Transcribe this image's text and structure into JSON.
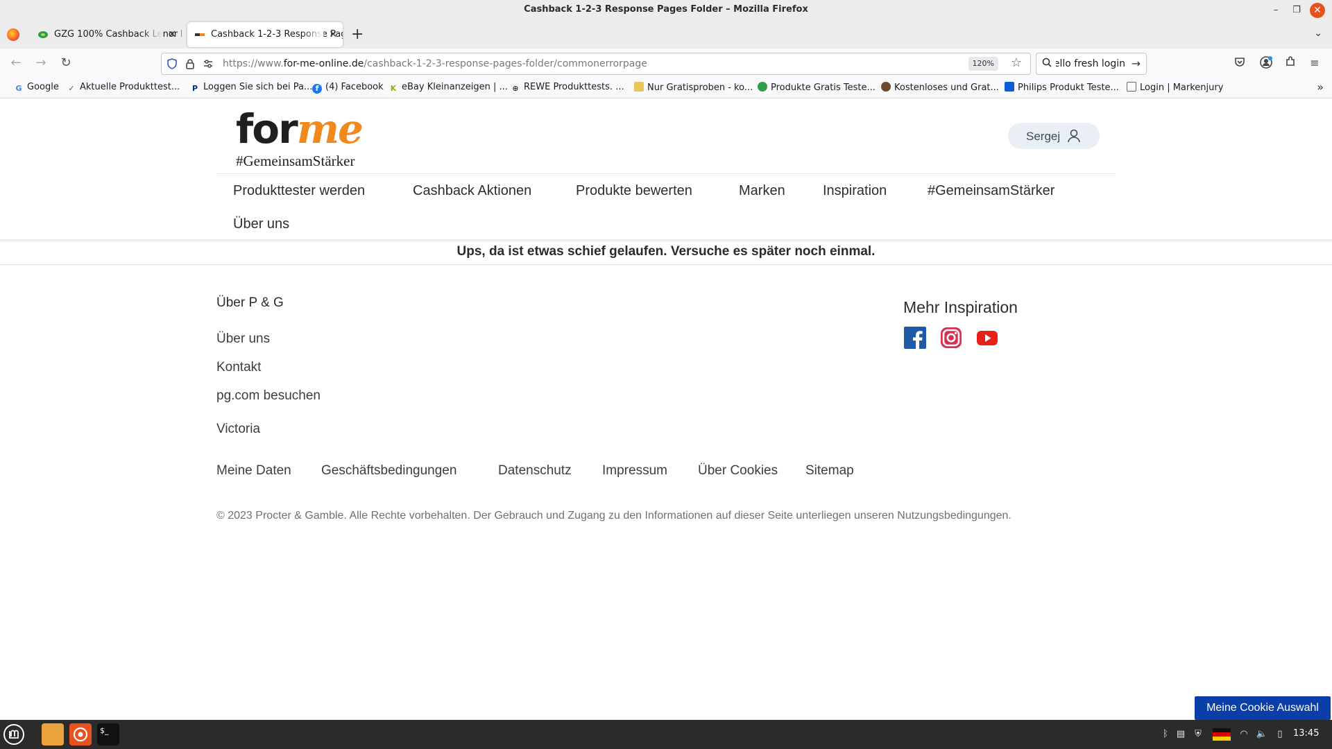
{
  "window": {
    "title": "Cashback 1-2-3 Response Pages Folder – Mozilla Firefox"
  },
  "tabs": [
    {
      "label": "GZG 100% Cashback Lenor F",
      "active": false
    },
    {
      "label": "Cashback 1-2-3 Response Pag",
      "active": true
    }
  ],
  "toolbar": {
    "url_prefix": "https://www.",
    "url_host": "for-me-online.de",
    "url_path": "/cashback-1-2-3-response-pages-folder/commonerrorpage",
    "zoom": "120%",
    "search_text": "hello fresh login"
  },
  "bookmarks": [
    {
      "label": "Google",
      "icon": "google-icon",
      "color": "#4285f4"
    },
    {
      "label": "Aktuelle Produkttest...",
      "icon": "check-icon",
      "color": "#2e7d32"
    },
    {
      "label": "Loggen Sie sich bei Pa...",
      "icon": "paypal-icon",
      "color": "#003087"
    },
    {
      "label": "(4) Facebook",
      "icon": "facebook-icon",
      "color": "#1877f2"
    },
    {
      "label": "eBay Kleinanzeigen | ...",
      "icon": "kleinanzeigen-icon",
      "color": "#86b817"
    },
    {
      "label": "REWE Produkttests. ...",
      "icon": "globe-icon",
      "color": "#333333"
    },
    {
      "label": "Nur Gratisproben - ko...",
      "icon": "folder-icon",
      "color": "#e8c65a"
    },
    {
      "label": "Produkte Gratis Teste...",
      "icon": "leaf-icon",
      "color": "#2e9e44"
    },
    {
      "label": "Kostenloses und Grat...",
      "icon": "mascot-icon",
      "color": "#6b4a2a"
    },
    {
      "label": "Philips Produkt Teste...",
      "icon": "shield-icon",
      "color": "#0b5ed7"
    },
    {
      "label": "Login | Markenjury",
      "icon": "page-icon",
      "color": "#666666"
    }
  ],
  "site": {
    "logo_main": "for",
    "logo_accent": "me",
    "logo_tagline": "#GemeinsamStärker",
    "brand_orange": "#f08a1c",
    "user_name": "Sergej",
    "nav": [
      "Produkttester werden",
      "Cashback Aktionen",
      "Produkte bewerten",
      "Marken",
      "Inspiration",
      "#GemeinsamStärker",
      "Über uns"
    ],
    "error_message": "Ups, da ist etwas schief gelaufen. Versuche es später noch einmal."
  },
  "footer": {
    "about_heading": "Über P & G",
    "links": [
      "Über uns",
      "Kontakt",
      "pg.com besuchen",
      "Victoria"
    ],
    "inspiration_heading": "Mehr Inspiration",
    "social": [
      "facebook-icon",
      "instagram-icon",
      "youtube-icon"
    ],
    "legal_links": [
      "Meine Daten",
      "Geschäftsbedingungen",
      "Datenschutz",
      "Impressum",
      "Über Cookies",
      "Sitemap"
    ],
    "copyright": "© 2023 Procter & Gamble. Alle Rechte vorbehalten. Der Gebrauch und Zugang zu den Informationen auf dieser Seite unterliegen unseren Nutzungsbedingungen."
  },
  "cookie_button": "Meine Cookie Auswahl",
  "taskbar": {
    "clock": "13:45",
    "accent": "#e8521e"
  }
}
